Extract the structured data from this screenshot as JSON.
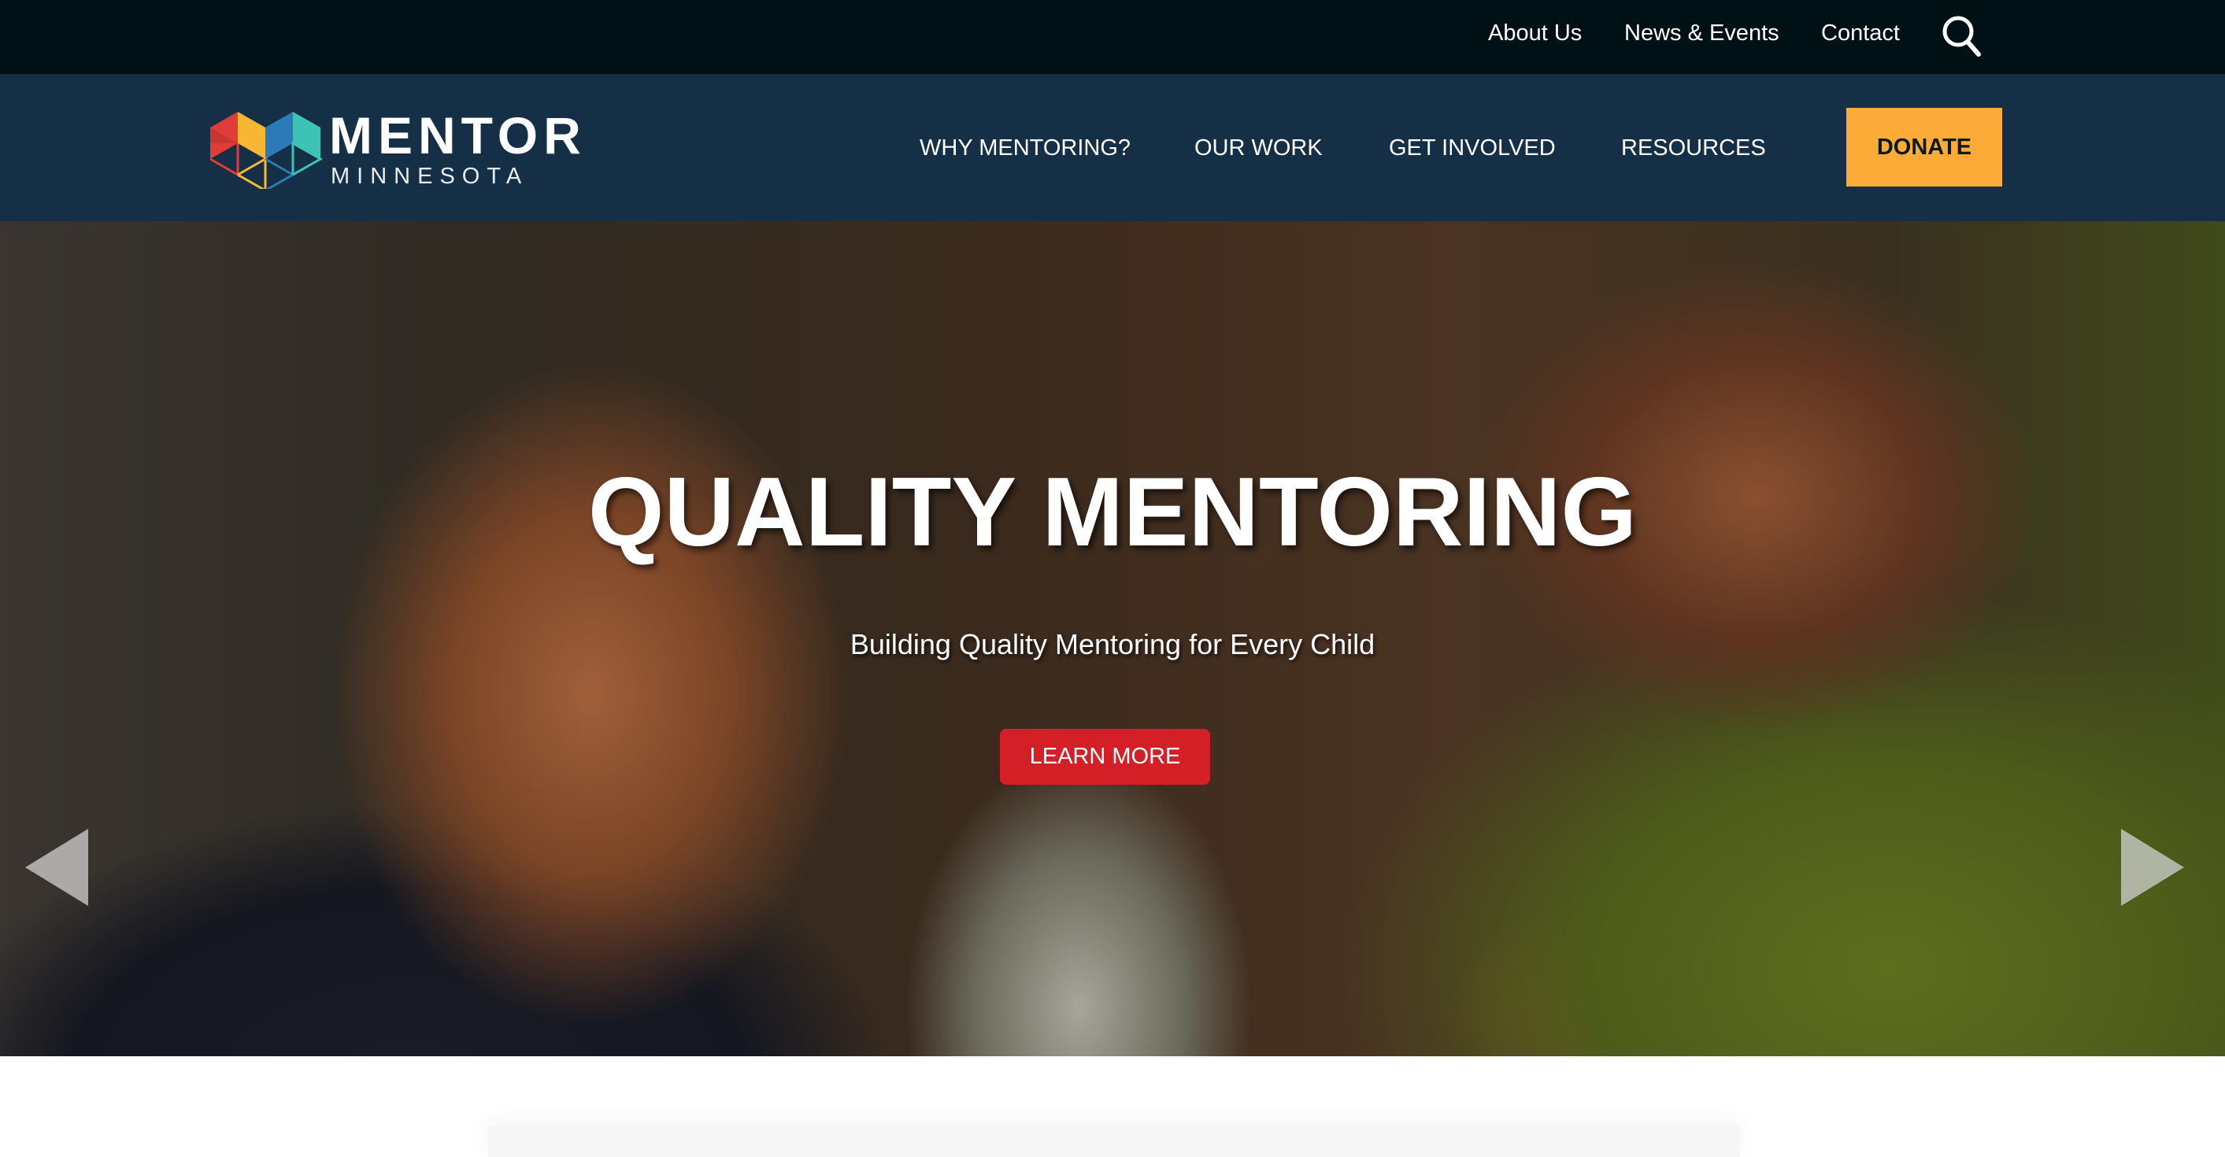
{
  "utility_nav": {
    "items": [
      {
        "label": "About Us"
      },
      {
        "label": "News & Events"
      },
      {
        "label": "Contact"
      }
    ],
    "search_icon": "search-icon"
  },
  "brand": {
    "name": "MENTOR",
    "subname": "MINNESOTA",
    "colors": [
      "#e03c3a",
      "#f7b733",
      "#2b7bb9",
      "#3cc3b6"
    ]
  },
  "main_nav": {
    "items": [
      {
        "label": "WHY MENTORING?"
      },
      {
        "label": "OUR WORK"
      },
      {
        "label": "GET INVOLVED"
      },
      {
        "label": "RESOURCES"
      }
    ],
    "donate_label": "DONATE",
    "donate_color": "#fdab38"
  },
  "hero": {
    "title": "QUALITY MENTORING",
    "subtitle": "Building Quality Mentoring for Every Child",
    "cta_label": "LEARN MORE",
    "cta_color": "#d41f27",
    "prev_icon": "triangle-left-icon",
    "next_icon": "triangle-right-icon"
  }
}
